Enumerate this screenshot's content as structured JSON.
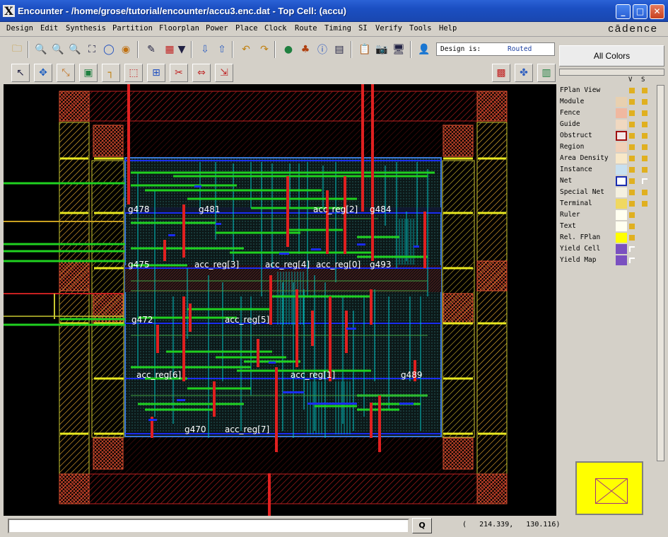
{
  "window": {
    "app_icon": "X",
    "title": "Encounter - /home/grose/tutorial/encounter/accu3.enc.dat - Top Cell: (accu)",
    "controls": [
      "minimize",
      "maximize",
      "close"
    ]
  },
  "menubar": {
    "items": [
      "Design",
      "Edit",
      "Synthesis",
      "Partition",
      "Floorplan",
      "Power",
      "Place",
      "Clock",
      "Route",
      "Timing",
      "SI",
      "Verify",
      "Tools",
      "Help"
    ],
    "brand": "cādence"
  },
  "toolbar1": {
    "icons": [
      "open-icon",
      "zoom-in-icon",
      "zoom-out-icon",
      "zoom-select-icon",
      "zoom-fit-icon",
      "redraw-icon",
      "refresh-icon",
      "highlight-icon",
      "color-fill-icon",
      "dropdown-icon",
      "flip-down-icon",
      "flip-up-icon",
      "undo-icon",
      "redo-icon",
      "globe-icon",
      "hierarchy-icon",
      "info-icon",
      "notes-icon",
      "clipboard-icon",
      "camera-icon",
      "monitor-icon",
      "person-icon"
    ],
    "design_label": "Design is:",
    "design_status": "Routed"
  },
  "toolbar2": {
    "icons": [
      "select-arrow-icon",
      "move-icon",
      "stretch-icon",
      "chip-icon",
      "route-icon",
      "select-box-icon",
      "measure-icon",
      "cut-icon",
      "align-icon",
      "resize-icon"
    ],
    "right_icons": [
      "floorplan-view-icon",
      "amoeba-view-icon",
      "physical-view-icon"
    ]
  },
  "layout": {
    "cell_labels": [
      "g478",
      "g481",
      "acc_reg[2]",
      "g484",
      "g475",
      "acc_reg[3]",
      "acc_reg[4]",
      "acc_reg[0]",
      "g493",
      "g472",
      "acc_reg[5]",
      "acc_reg[6]",
      "acc_reg[1]",
      "g489",
      "g470",
      "acc_reg[7]"
    ],
    "colors": {
      "background": "#000000",
      "power_ring": "#e02020",
      "io_pad": "#c8c830",
      "core_box": "#3a78d8",
      "metal1": "#00c8c8",
      "metal2": "#20d020",
      "metal3": "#e02020",
      "blue": "#1a2cf0"
    }
  },
  "right_panel": {
    "all_colors_label": "All Colors",
    "col_v": "V",
    "col_s": "S",
    "layers": [
      {
        "name": "FPlan View",
        "swatch": "",
        "v": "on",
        "s": "on"
      },
      {
        "name": "Module",
        "swatch": "#e8d0b0",
        "v": "on",
        "s": "on"
      },
      {
        "name": "Fence",
        "swatch": "#f0b8a0",
        "v": "on",
        "s": "on"
      },
      {
        "name": "Guide",
        "swatch": "#f0d8c0",
        "v": "on",
        "s": "on"
      },
      {
        "name": "Obstruct",
        "swatch": "#f4e8e8",
        "v": "on",
        "s": "on"
      },
      {
        "name": "Region",
        "swatch": "#f0d0b8",
        "v": "on",
        "s": "on"
      },
      {
        "name": "Area Density",
        "swatch": "#f8e8c8",
        "v": "on",
        "s": "on"
      },
      {
        "name": "Instance",
        "swatch": "#c8e0f0",
        "v": "on",
        "s": "on"
      },
      {
        "name": "Net",
        "swatch": "#ffffff",
        "v": "on",
        "s": "off"
      },
      {
        "name": "Special Net",
        "swatch": "#f4f0e0",
        "v": "on",
        "s": "on"
      },
      {
        "name": "Terminal",
        "swatch": "#f0d860",
        "v": "on",
        "s": "on"
      },
      {
        "name": "Ruler",
        "swatch": "#fffff0",
        "v": "on",
        "s": ""
      },
      {
        "name": "Text",
        "swatch": "#fffff0",
        "v": "on",
        "s": ""
      },
      {
        "name": "Rel. FPlan",
        "swatch": "#ffff00",
        "v": "on",
        "s": ""
      },
      {
        "name": "Yield Cell",
        "swatch": "#7a50c0",
        "v": "off",
        "s": ""
      },
      {
        "name": "Yield Map",
        "swatch": "#7a50c0",
        "v": "off",
        "s": ""
      }
    ]
  },
  "statusbar": {
    "command_value": "",
    "query_button": "Q",
    "coordinates": "(   214.339,   130.116)"
  }
}
